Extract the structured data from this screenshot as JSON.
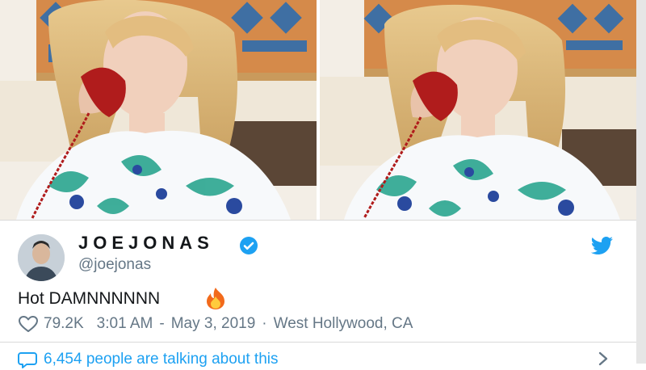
{
  "tweet": {
    "author": {
      "display_name": "JOEJONAS",
      "handle": "@joejonas"
    },
    "text": "Hot DAMNNNNNN",
    "emoji": "fire",
    "likes": "79.2K",
    "time": "3:01 AM",
    "date_separator": "-",
    "date": "May 3, 2019",
    "location": "West Hollywood, CA",
    "talking": "6,454 people are talking about this"
  },
  "icons": {
    "verified": "verified-badge-icon",
    "brand": "twitter-bird-icon",
    "like": "heart-icon",
    "reply": "comment-bubble-icon",
    "more": "chevron-right-icon"
  },
  "colors": {
    "accent": "#1da1f2",
    "muted": "#657786",
    "text": "#14171a"
  }
}
